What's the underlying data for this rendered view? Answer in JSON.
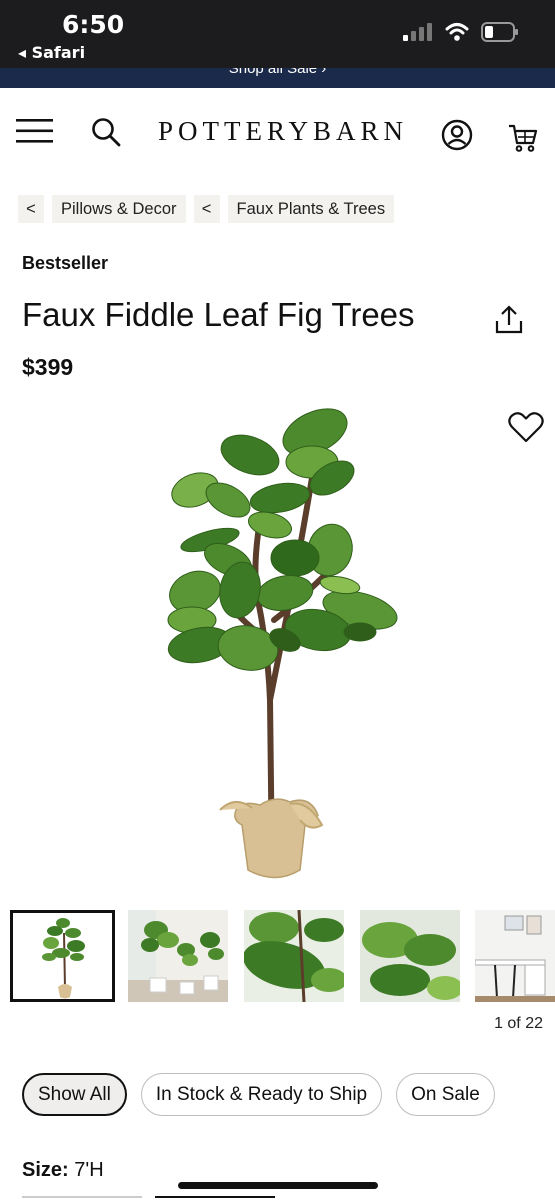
{
  "status_bar": {
    "time": "6:50",
    "back_label": "◂ Safari",
    "signal_icon": "cellular-signal-icon",
    "wifi_icon": "wifi-icon",
    "battery_icon": "battery-icon"
  },
  "promo": {
    "text": "Shop all Sale ›"
  },
  "header": {
    "logo_text": "POTTERYBARN",
    "menu_icon": "hamburger-menu-icon",
    "search_icon": "search-icon",
    "account_icon": "account-icon",
    "cart_icon": "cart-icon"
  },
  "breadcrumbs": [
    {
      "arrow": "<",
      "label": "Pillows & Decor"
    },
    {
      "arrow": "<",
      "label": "Faux Plants & Trees"
    }
  ],
  "product": {
    "badge": "Bestseller",
    "title": "Faux Fiddle Leaf Fig Trees",
    "price": "$399",
    "share_icon": "share-icon",
    "favorite_icon": "heart-icon"
  },
  "gallery": {
    "counter": "1 of 22",
    "thumbnails": [
      "thumbnail-tree",
      "thumbnail-room-trees",
      "thumbnail-leaf-closeup",
      "thumbnail-leaves",
      "thumbnail-office"
    ]
  },
  "filters": [
    {
      "label": "Show All",
      "active": true
    },
    {
      "label": "In Stock & Ready to Ship",
      "active": false
    },
    {
      "label": "On Sale",
      "active": false
    }
  ],
  "size": {
    "label": "Size:",
    "value": "7'H"
  },
  "colors": {
    "header_bg": "#1c1c1e",
    "promo_bg": "#1b2a4a",
    "leaf": "#4d8a2e",
    "burlap": "#d8c094"
  }
}
